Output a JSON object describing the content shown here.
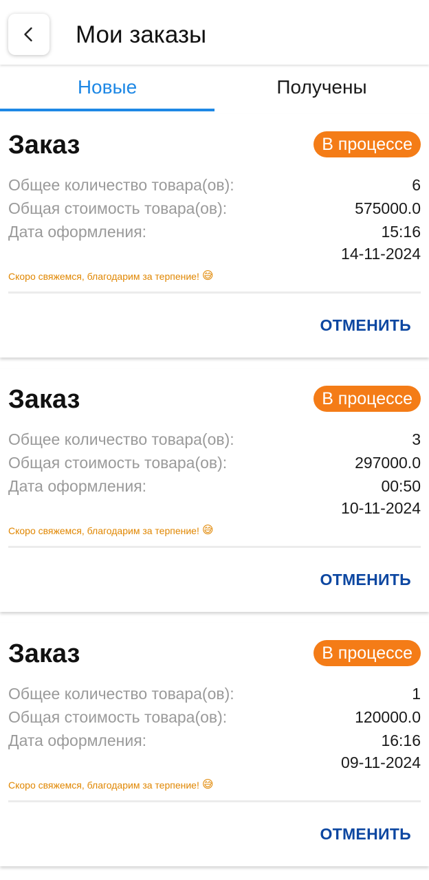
{
  "header": {
    "title": "Мои заказы",
    "back_icon": "chevron-left-icon"
  },
  "tabs": [
    {
      "label": "Новые",
      "active": true
    },
    {
      "label": "Получены",
      "active": false
    }
  ],
  "colors": {
    "accent": "#1e88e5",
    "status_badge": "#f47c17",
    "note_text": "#e08600",
    "cancel_text": "#0d47a1"
  },
  "orders": [
    {
      "title": "Заказ",
      "status": "В процессе",
      "quantity_label": "Общее количество товара(ов):",
      "quantity": "6",
      "cost_label": "Общая стоимость товара(ов):",
      "cost": "575000.0",
      "date_label": "Дата оформления:",
      "time": "15:16",
      "date": "14-11-2024",
      "note": "Скоро свяжемся, благодарим за терпение!",
      "note_emoji": "😅",
      "cancel_label": "ОТМЕНИТЬ"
    },
    {
      "title": "Заказ",
      "status": "В процессе",
      "quantity_label": "Общее количество товара(ов):",
      "quantity": "3",
      "cost_label": "Общая стоимость товара(ов):",
      "cost": "297000.0",
      "date_label": "Дата оформления:",
      "time": "00:50",
      "date": "10-11-2024",
      "note": "Скоро свяжемся, благодарим за терпение!",
      "note_emoji": "😅",
      "cancel_label": "ОТМЕНИТЬ"
    },
    {
      "title": "Заказ",
      "status": "В процессе",
      "quantity_label": "Общее количество товара(ов):",
      "quantity": "1",
      "cost_label": "Общая стоимость товара(ов):",
      "cost": "120000.0",
      "date_label": "Дата оформления:",
      "time": "16:16",
      "date": "09-11-2024",
      "note": "Скоро свяжемся, благодарим за терпение!",
      "note_emoji": "😅",
      "cancel_label": "ОТМЕНИТЬ"
    }
  ]
}
